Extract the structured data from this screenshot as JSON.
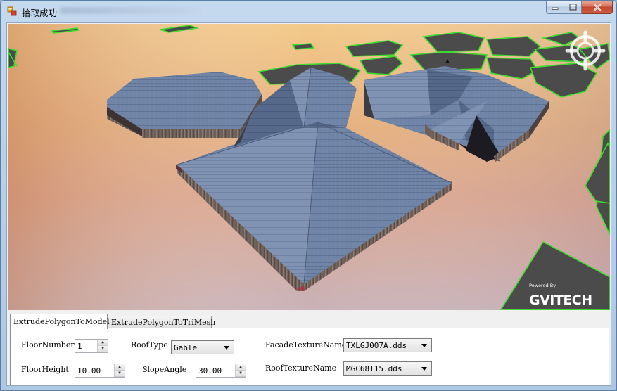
{
  "window": {
    "title": "拾取成功",
    "buttons": {
      "minimize": "minimize",
      "maximize": "maximize",
      "close": "close"
    }
  },
  "viewport": {
    "watermark_top": "Powered By",
    "watermark_brand": "GVITECH",
    "compass_letter": "N"
  },
  "tabs": [
    {
      "label": "ExtrudePolygonToModel",
      "active": true
    },
    {
      "label": "ExtrudePolygonToTriMesh",
      "active": false
    }
  ],
  "form": {
    "floor_number": {
      "label": "FloorNumber",
      "value": "1"
    },
    "floor_height": {
      "label": "FloorHeight",
      "value": "10.00"
    },
    "roof_type": {
      "label": "RoofType",
      "value": "Gable"
    },
    "slope_angle": {
      "label": "SlopeAngle",
      "value": "30.00"
    },
    "facade_texture": {
      "label": "FacadeTextureName",
      "value": "TXLGJ007A.dds"
    },
    "roof_texture": {
      "label": "RoofTextureName",
      "value": "MGC68T15.dds"
    }
  },
  "colors": {
    "outline_green": "#3fdc2e",
    "roof_blue": "#6d82a3",
    "ground_dark": "#4a4a4a"
  }
}
